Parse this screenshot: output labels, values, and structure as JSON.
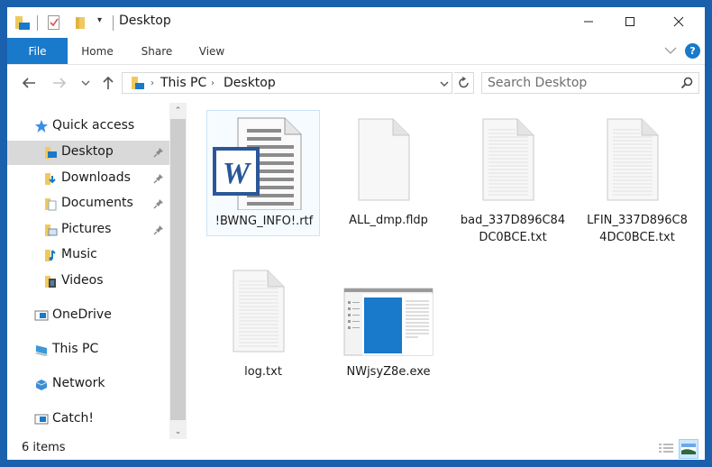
{
  "window": {
    "title": "Desktop",
    "accent_color": "#1979ca",
    "border_color": "#1a60ad",
    "controls": {
      "minimize": "minimize-icon",
      "maximize": "maximize-icon",
      "close": "close-icon"
    }
  },
  "quick_access_toolbar": {
    "icons": [
      "explorer-icon",
      "properties-icon",
      "new-folder-icon",
      "customize-dropdown-icon"
    ]
  },
  "ribbon": {
    "tabs": [
      {
        "label": "File",
        "active": true
      },
      {
        "label": "Home"
      },
      {
        "label": "Share"
      },
      {
        "label": "View"
      }
    ],
    "help_label": "?"
  },
  "navbar": {
    "back": "back-arrow-icon",
    "forward": "forward-arrow-icon",
    "recent": "recent-locations-icon",
    "up": "up-arrow-icon",
    "breadcrumb": [
      "This PC",
      "Desktop"
    ],
    "search_placeholder": "Search Desktop"
  },
  "sidebar": {
    "items": [
      {
        "label": "Quick access",
        "icon": "star-icon",
        "level": 0
      },
      {
        "label": "Desktop",
        "icon": "desktop-folder-icon",
        "level": 1,
        "pinned": true,
        "selected": true
      },
      {
        "label": "Downloads",
        "icon": "downloads-folder-icon",
        "level": 1,
        "pinned": true
      },
      {
        "label": "Documents",
        "icon": "documents-folder-icon",
        "level": 1,
        "pinned": true
      },
      {
        "label": "Pictures",
        "icon": "pictures-folder-icon",
        "level": 1,
        "pinned": true
      },
      {
        "label": "Music",
        "icon": "music-folder-icon",
        "level": 1
      },
      {
        "label": "Videos",
        "icon": "videos-folder-icon",
        "level": 1
      },
      {
        "label": "OneDrive",
        "icon": "onedrive-icon",
        "level": 0
      },
      {
        "label": "This PC",
        "icon": "computer-icon",
        "level": 0
      },
      {
        "label": "Network",
        "icon": "network-icon",
        "level": 0
      },
      {
        "label": "Catch!",
        "icon": "drive-icon",
        "level": 0
      }
    ]
  },
  "files": [
    {
      "name_lines": [
        "!BWNG_INFO!.rtf"
      ],
      "type": "word",
      "selected": true
    },
    {
      "name_lines": [
        "ALL_dmp.fldp"
      ],
      "type": "blank"
    },
    {
      "name_lines": [
        "bad_337D896C84",
        "DC0BCE.txt"
      ],
      "type": "text"
    },
    {
      "name_lines": [
        "LFIN_337D896C8",
        "4DC0BCE.txt"
      ],
      "type": "text"
    },
    {
      "name_lines": [
        "log.txt"
      ],
      "type": "text"
    },
    {
      "name_lines": [
        "NWjsyZ8e.exe"
      ],
      "type": "exe"
    }
  ],
  "status": {
    "item_count": "6 items",
    "views": [
      "details-view-icon",
      "large-icons-view-icon"
    ],
    "active_view": "large-icons-view-icon"
  }
}
